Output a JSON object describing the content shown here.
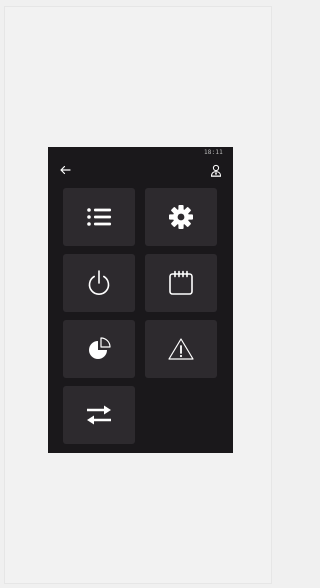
{
  "status_bar": {
    "time": "18:11"
  },
  "header": {
    "back_icon": "arrow-left-icon",
    "user_icon": "user-icon"
  },
  "tiles": [
    {
      "icon": "list-icon"
    },
    {
      "icon": "gear-icon"
    },
    {
      "icon": "power-icon"
    },
    {
      "icon": "calendar-icon"
    },
    {
      "icon": "pie-chart-icon"
    },
    {
      "icon": "warning-icon"
    },
    {
      "icon": "swap-arrows-icon"
    }
  ],
  "colors": {
    "page_background": "#f0f0f0",
    "screen_background": "#1a181b",
    "tile_background": "#2d2a2e",
    "icon_color": "#ffffff"
  }
}
